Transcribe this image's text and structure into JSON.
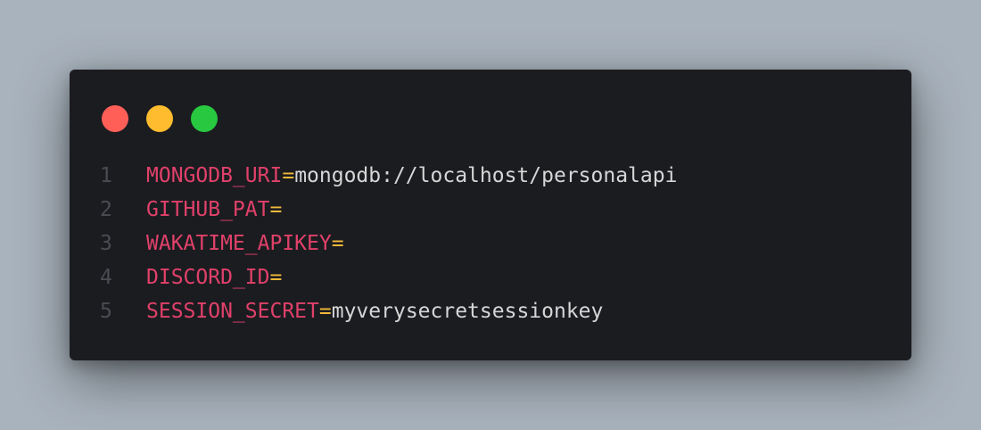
{
  "colors": {
    "close": "#ff5f57",
    "minimize": "#febc2e",
    "maximize": "#28c840"
  },
  "lines": [
    {
      "num": "1",
      "key": "MONGODB_URI",
      "eq": "=",
      "value": "mongodb://localhost/personalapi"
    },
    {
      "num": "2",
      "key": "GITHUB_PAT",
      "eq": "=",
      "value": ""
    },
    {
      "num": "3",
      "key": "WAKATIME_APIKEY",
      "eq": "=",
      "value": ""
    },
    {
      "num": "4",
      "key": "DISCORD_ID",
      "eq": "=",
      "value": ""
    },
    {
      "num": "5",
      "key": "SESSION_SECRET",
      "eq": "=",
      "value": "myverysecretsessionkey"
    }
  ]
}
